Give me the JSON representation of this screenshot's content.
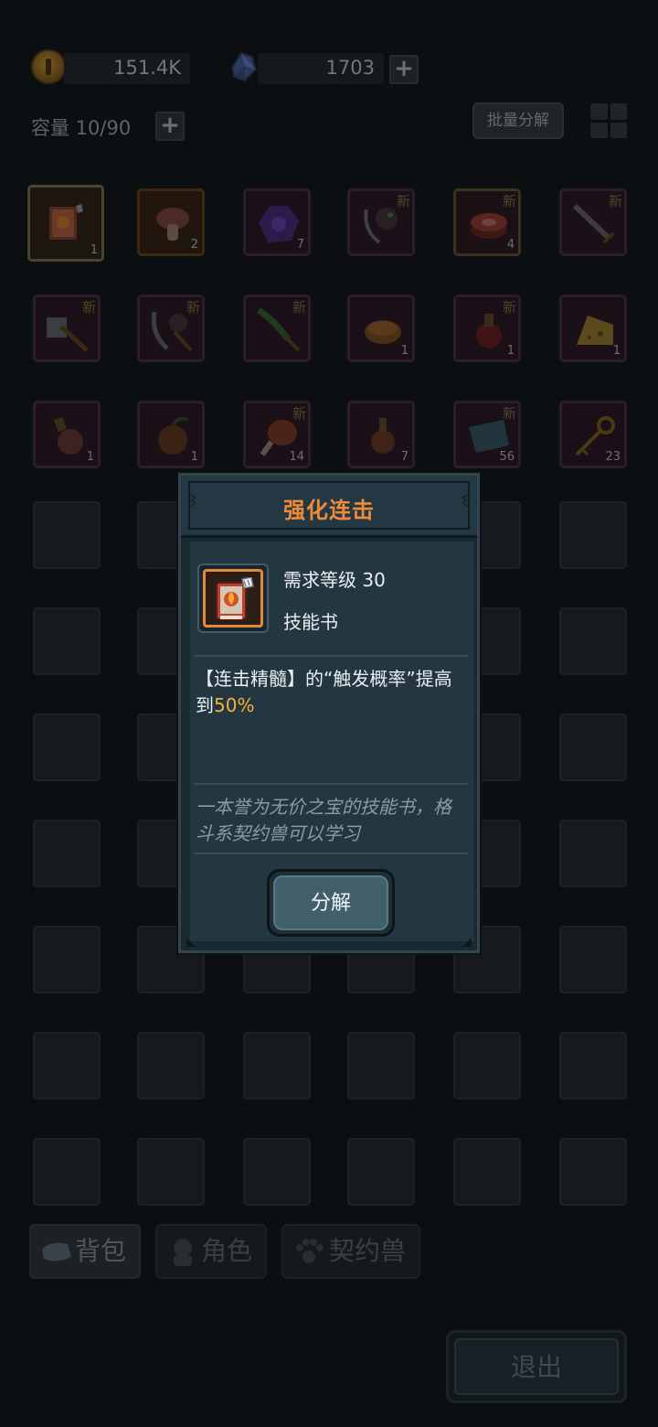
{
  "currencies": {
    "coins": {
      "value": "151.4K",
      "icon": "coin-icon"
    },
    "gems": {
      "value": "1703",
      "icon": "crystal-icon"
    },
    "add_label": "+"
  },
  "inventory": {
    "capacity_label": "容量 10/90",
    "batch_decompose_label": "批量分解",
    "new_tag": "新",
    "rows": [
      [
        {
          "name": "skill-book",
          "count": "1",
          "new": false,
          "color": "selected"
        },
        {
          "name": "mushroom",
          "count": "2",
          "new": false,
          "color": "orange"
        },
        {
          "name": "purple-orb",
          "count": "7",
          "new": false,
          "color": "purple"
        },
        {
          "name": "beast-bow",
          "count": "",
          "new": true,
          "color": "purple"
        },
        {
          "name": "meat",
          "count": "4",
          "new": true,
          "color": "gold"
        },
        {
          "name": "great-sword",
          "count": "",
          "new": true,
          "color": "purple"
        }
      ],
      [
        {
          "name": "war-hammer",
          "count": "",
          "new": true,
          "color": "purple"
        },
        {
          "name": "beast-scythe",
          "count": "",
          "new": true,
          "color": "purple"
        },
        {
          "name": "green-spear",
          "count": "",
          "new": true,
          "color": "purple"
        },
        {
          "name": "bread",
          "count": "1",
          "new": false,
          "color": "purple"
        },
        {
          "name": "red-flask",
          "count": "1",
          "new": true,
          "color": "purple"
        },
        {
          "name": "cheese",
          "count": "1",
          "new": false,
          "color": "purple"
        }
      ],
      [
        {
          "name": "potion-bottle",
          "count": "1",
          "new": false,
          "color": "purple"
        },
        {
          "name": "devil-fruit",
          "count": "1",
          "new": false,
          "color": "purple"
        },
        {
          "name": "ham",
          "count": "14",
          "new": true,
          "color": "purple"
        },
        {
          "name": "orange-flask",
          "count": "7",
          "new": false,
          "color": "purple"
        },
        {
          "name": "map-scroll",
          "count": "56",
          "new": true,
          "color": "purple"
        },
        {
          "name": "golden-key",
          "count": "23",
          "new": false,
          "color": "purple"
        }
      ]
    ]
  },
  "tabs": [
    {
      "label": "背包",
      "icon": "bag-icon",
      "active": true
    },
    {
      "label": "角色",
      "icon": "character-icon",
      "active": false
    },
    {
      "label": "契约兽",
      "icon": "paw-icon",
      "active": false
    }
  ],
  "exit_label": "退出",
  "modal": {
    "title": "强化连击",
    "required_level": "需求等级 30",
    "item_type": "技能书",
    "effect_prefix": "【连击精髓】的“触发概率”提高到",
    "effect_value": "50%",
    "flavor": "一本誉为无价之宝的技能书，格斗系契约兽可以学习",
    "decompose_label": "分解",
    "accent_color": "#f08a3a",
    "highlight_color": "#f2b23a"
  }
}
